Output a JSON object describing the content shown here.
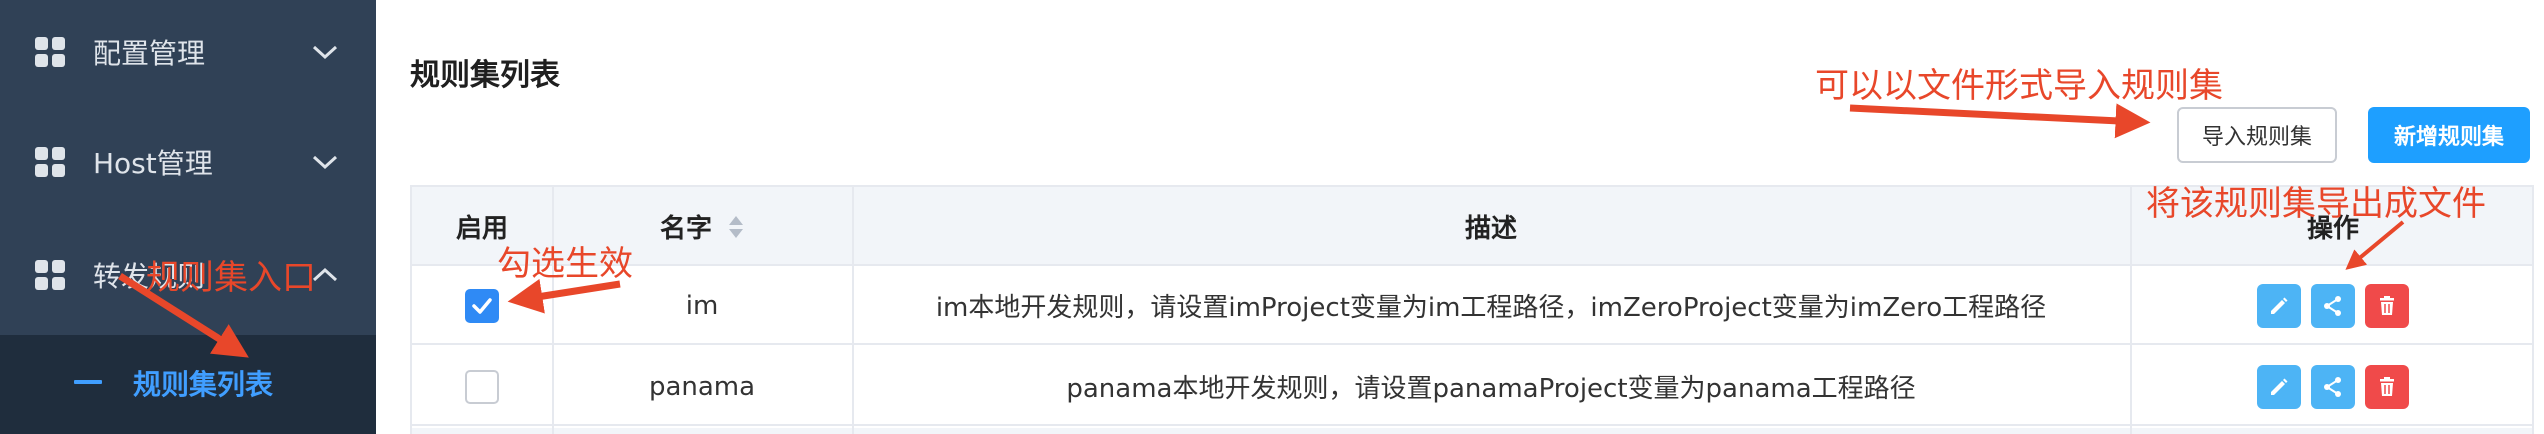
{
  "sidebar": {
    "items": [
      {
        "label": "配置管理"
      },
      {
        "label": "Host管理"
      },
      {
        "label": "转发规则"
      }
    ],
    "submenu": {
      "label": "规则集列表"
    }
  },
  "main": {
    "title": "规则集列表",
    "buttons": {
      "import": "导入规则集",
      "new": "新增规则集"
    },
    "table": {
      "headers": {
        "enable": "启用",
        "name": "名字",
        "desc": "描述",
        "ops": "操作"
      },
      "rows": [
        {
          "enabled": true,
          "name": "im",
          "desc": "im本地开发规则，请设置imProject变量为im工程路径，imZeroProject变量为imZero工程路径"
        },
        {
          "enabled": false,
          "name": "panama",
          "desc": "panama本地开发规则，请设置panamaProject变量为panama工程路径"
        }
      ]
    }
  },
  "annotations": {
    "import_hint": "可以以文件形式导入规则集",
    "export_hint": "将该规则集导出成文件",
    "check_hint": "勾选生效",
    "entry_hint": "规则集入口"
  },
  "colors": {
    "sidebar_bg": "#304156",
    "active_blue": "#409eff",
    "primary_button": "#1e9fff",
    "annotation_red": "#e8472a",
    "delete_red": "#f04a4a"
  }
}
